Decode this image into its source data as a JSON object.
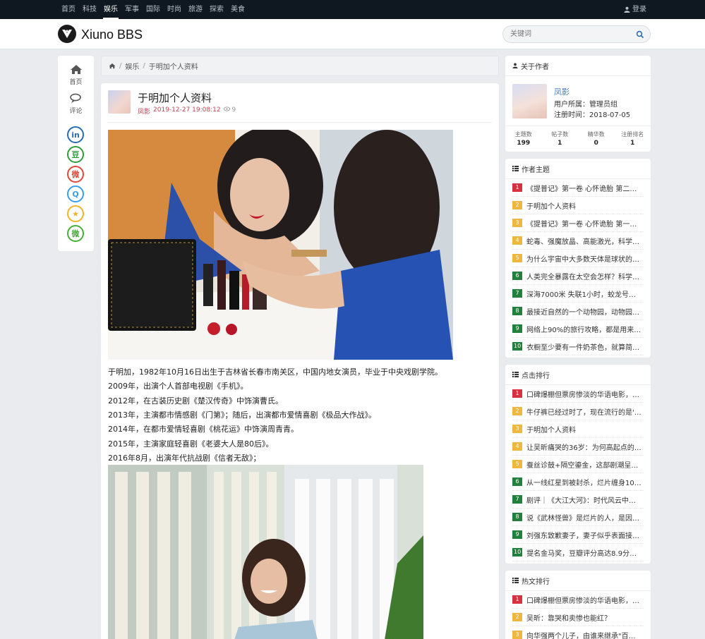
{
  "topnav": {
    "items": [
      "首页",
      "科技",
      "娱乐",
      "军事",
      "国际",
      "时尚",
      "旅游",
      "探索",
      "美食"
    ],
    "active_index": 2,
    "login_label": "登录"
  },
  "header": {
    "logo_text": "Xiuno BBS",
    "search_placeholder": "关键词"
  },
  "left_nav": {
    "home_label": "首页",
    "comment_label": "评论",
    "social": [
      {
        "icon": "linkedin-icon",
        "glyph": "in",
        "color": "#2a6cb0"
      },
      {
        "icon": "douban-icon",
        "glyph": "豆",
        "color": "#2f9d3b"
      },
      {
        "icon": "weibo-icon",
        "glyph": "微",
        "color": "#e0483b"
      },
      {
        "icon": "qq-icon",
        "glyph": "Q",
        "color": "#3a9ee5"
      },
      {
        "icon": "qzone-icon",
        "glyph": "★",
        "color": "#f0b428"
      },
      {
        "icon": "wechat-icon",
        "glyph": "微",
        "color": "#45b035"
      }
    ]
  },
  "breadcrumb": {
    "home_icon": "home-icon",
    "category": "娱乐",
    "current": "于明加个人资料"
  },
  "post": {
    "title": "于明加个人资料",
    "author": "凤影",
    "datetime": "2019-12-27 19:08:12",
    "views": "9",
    "paragraphs": [
      "于明加，1982年10月16日出生于吉林省长春市南关区，中国内地女演员，毕业于中央戏剧学院。",
      "2009年，出演个人首部电视剧《手机》。",
      "2012年，在古装历史剧《楚汉传奇》中饰演曹氏。",
      "2013年，主演都市情感剧《门第》；随后，出演都市爱情喜剧《极品大作战》。",
      "2014年，在都市爱情轻喜剧《桃花运》中饰演周青青。",
      "2015年，主演家庭轻喜剧《老婆大人是80后》。",
      "2016年8月，出演年代抗战剧《信者无敌》；"
    ]
  },
  "about_author": {
    "heading": "关于作者",
    "name": "凤影",
    "group_line": "用户所属：管理员组",
    "register_line": "注册时间：2018-07-05",
    "stats": [
      {
        "label": "主题数",
        "value": "199"
      },
      {
        "label": "帖子数",
        "value": "1"
      },
      {
        "label": "精华数",
        "value": "0"
      },
      {
        "label": "注册排名",
        "value": "1"
      }
    ]
  },
  "author_topics": {
    "heading": "作者主题",
    "items": [
      {
        "n": "1",
        "text": "《提普记》第一卷 心怀诡胎 第二章…"
      },
      {
        "n": "2",
        "text": "于明加个人资料"
      },
      {
        "n": "3",
        "text": "《提普记》第一卷 心怀诡胎 第一章…"
      },
      {
        "n": "4",
        "text": "蛇毒、强魔放晶、高能激光，科学…"
      },
      {
        "n": "5",
        "text": "为什么宇宙中大多数天体是球状的…"
      },
      {
        "n": "6",
        "text": "人类完全暴露在太空会怎样？科学…"
      },
      {
        "n": "7",
        "text": "深海7000米 失联1小时，蛟龙号在…"
      },
      {
        "n": "8",
        "text": "最接近自然的一个动物园，动物园…"
      },
      {
        "n": "9",
        "text": "网络上90%的旅行攻略，都是用来…"
      },
      {
        "n": "10",
        "text": "衣橱至少要有一件奶茶色，就算简…"
      }
    ]
  },
  "click_rank": {
    "heading": "点击排行",
    "items": [
      {
        "n": "1",
        "text": "口碑爆棚但票房惨淡的华语电影，…"
      },
      {
        "n": "2",
        "text": "牛仔裤已经过时了，现在流行的是'…"
      },
      {
        "n": "3",
        "text": "于明加个人资料"
      },
      {
        "n": "4",
        "text": "让吴昕痛哭的36岁：为何高起点的…"
      },
      {
        "n": "5",
        "text": "蚕丝诊鼓+隔空鎏金，这部剧潮呈现…"
      },
      {
        "n": "6",
        "text": "从一线红星到被封杀，烂片缠身10…"
      },
      {
        "n": "7",
        "text": "剧评｜《大江大河》：时代风云中…"
      },
      {
        "n": "8",
        "text": "说《武林怪兽》是烂片的人，是因…"
      },
      {
        "n": "9",
        "text": "刘强东致歉妻子，妻子似乎表面接…"
      },
      {
        "n": "10",
        "text": "提名金马奖，豆瓣评分高达8.9分，…"
      }
    ]
  },
  "hot_rank": {
    "heading": "热文排行",
    "items": [
      {
        "n": "1",
        "text": "口碑爆棚但票房惨淡的华语电影，…"
      },
      {
        "n": "2",
        "text": "吴昕：靠哭和卖惨也能红？"
      },
      {
        "n": "3",
        "text": "向华强两个儿子，由谁来继承\"百亿\"…"
      }
    ]
  }
}
